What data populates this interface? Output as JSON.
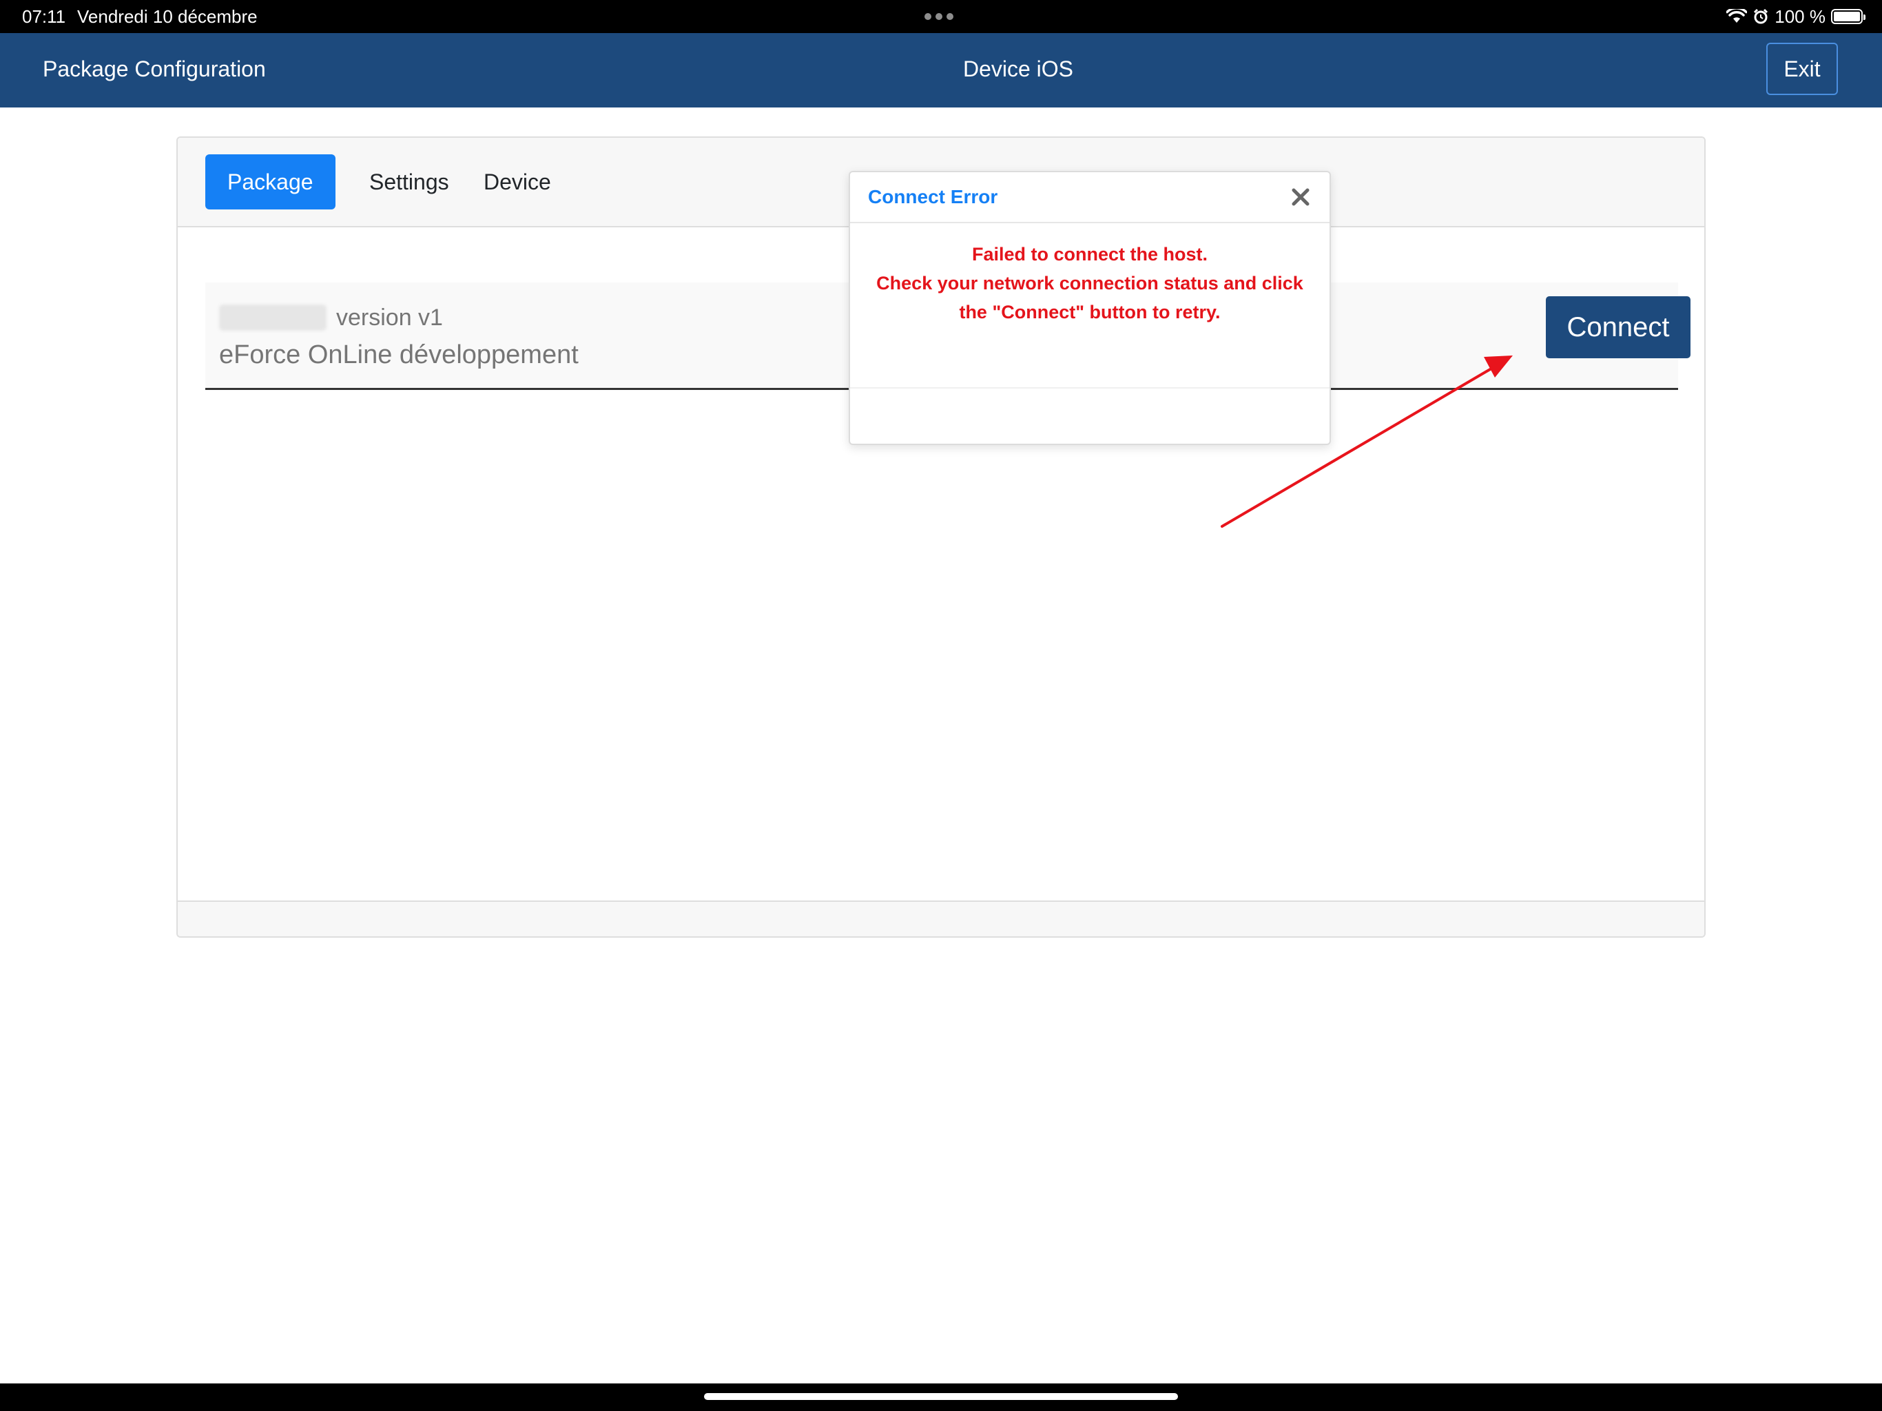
{
  "status_bar": {
    "time": "07:11",
    "date": "Vendredi 10 décembre",
    "battery": "100 %",
    "icons": [
      "wifi-icon",
      "alarm-icon",
      "battery-icon"
    ]
  },
  "header": {
    "title": "Package Configuration",
    "center_title": "Device iOS",
    "exit_label": "Exit",
    "background_color": "#1d4a7d"
  },
  "tabs": [
    {
      "label": "Package",
      "active": true
    },
    {
      "label": "Settings",
      "active": false
    },
    {
      "label": "Device",
      "active": false
    }
  ],
  "package": {
    "version": "version v1",
    "name": "eForce OnLine développement",
    "connect_label": "Connect"
  },
  "modal": {
    "title": "Connect Error",
    "messages": [
      "Failed to connect the host.",
      "Check your network connection status and click",
      "the \"Connect\" button to retry."
    ],
    "title_color": "#1580f5",
    "message_color": "#e4141b"
  },
  "annotation": {
    "arrow_color": "#e8141c"
  }
}
